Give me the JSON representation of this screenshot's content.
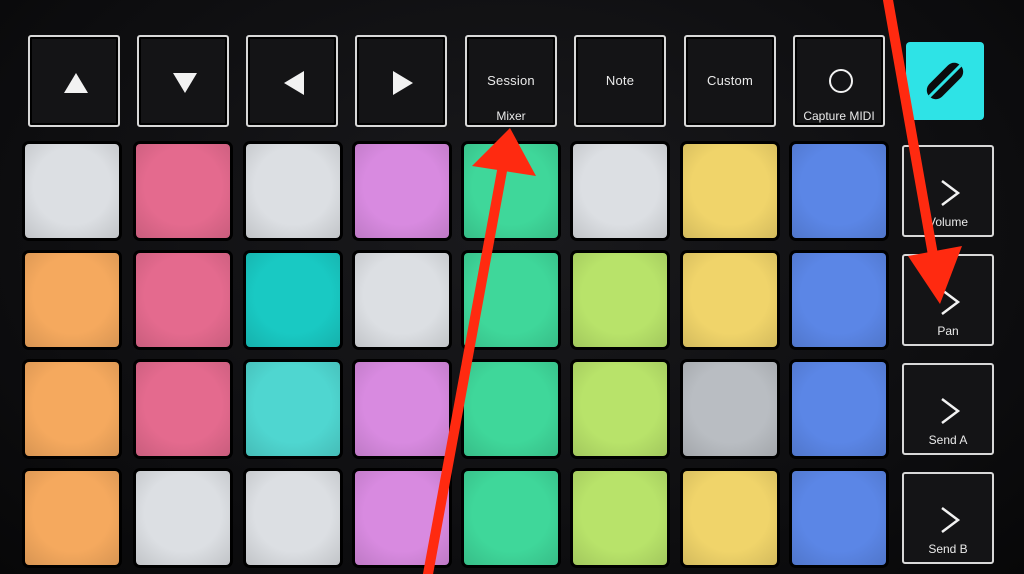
{
  "top_buttons": [
    {
      "name": "up-arrow-button",
      "icon": "up-arrow-icon",
      "label": ""
    },
    {
      "name": "down-arrow-button",
      "icon": "down-arrow-icon",
      "label": ""
    },
    {
      "name": "left-arrow-button",
      "icon": "left-arrow-icon",
      "label": ""
    },
    {
      "name": "right-arrow-button",
      "icon": "right-arrow-icon",
      "label": ""
    },
    {
      "name": "session-button",
      "label": "Session",
      "sublabel": "Mixer"
    },
    {
      "name": "note-button",
      "label": "Note"
    },
    {
      "name": "custom-button",
      "label": "Custom"
    },
    {
      "name": "capture-midi-button",
      "icon": "circle-icon",
      "label": "Capture MIDI"
    }
  ],
  "logo": {
    "icon": "novation-logo-icon",
    "color": "#2ee3e6"
  },
  "side_buttons": [
    {
      "name": "volume-button",
      "icon": "chevron-right-icon",
      "label": "Volume"
    },
    {
      "name": "pan-button",
      "icon": "chevron-right-icon",
      "label": "Pan"
    },
    {
      "name": "send-a-button",
      "icon": "chevron-right-icon",
      "label": "Send A"
    },
    {
      "name": "send-b-button",
      "icon": "chevron-right-icon",
      "label": "Send B"
    }
  ],
  "pad_colors": [
    [
      "#dcdfe3",
      "#e46a8e",
      "#dcdfe3",
      "#d88ae0",
      "#3fd79a",
      "#dcdfe3",
      "#f0d46a",
      "#5b86e6"
    ],
    [
      "#f5a95e",
      "#e46a8e",
      "#19c9c3",
      "#dcdfe3",
      "#3fd79a",
      "#b8e36a",
      "#f0d46a",
      "#5b86e6"
    ],
    [
      "#f5a95e",
      "#e46a8e",
      "#4fd6d0",
      "#d88ae0",
      "#3fd79a",
      "#b8e36a",
      "#b9bdc2",
      "#5b86e6"
    ],
    [
      "#f5a95e",
      "#dcdfe3",
      "#dcdfe3",
      "#d88ae0",
      "#3fd79a",
      "#b8e36a",
      "#f0d46a",
      "#5b86e6"
    ]
  ],
  "annotation_color": "#ff2a10"
}
